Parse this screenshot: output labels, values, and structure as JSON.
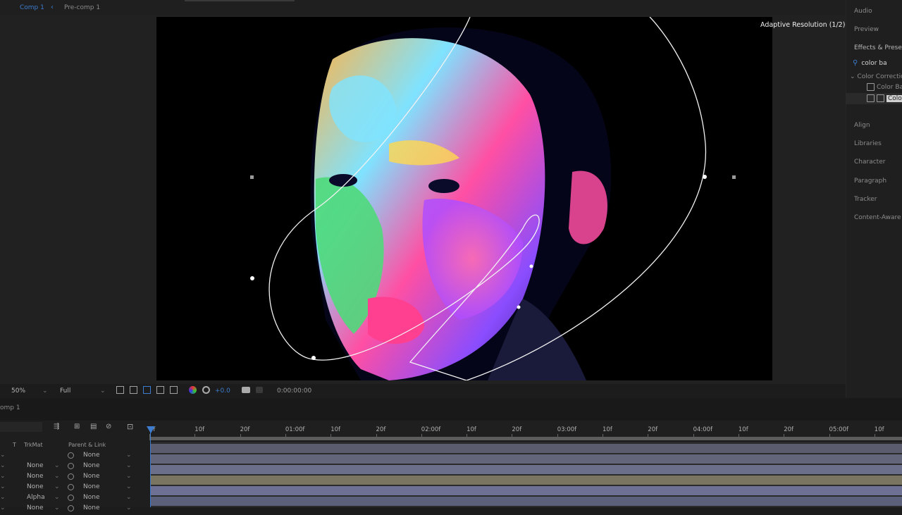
{
  "breadcrumb": {
    "comp": "Comp 1",
    "separator": "‹",
    "precomp": "Pre-comp 1"
  },
  "viewer": {
    "adaptive_resolution": "Adaptive Resolution (1/2)"
  },
  "right_panel": {
    "items_top": [
      "Audio",
      "Preview",
      "Effects & Presets"
    ],
    "search_value": "color ba",
    "category": "Color Correctio",
    "effect_1": "Color Ba",
    "effect_2": "Colo",
    "items_bottom": [
      "Align",
      "Libraries",
      "Character",
      "Paragraph",
      "Tracker",
      "Content-Aware"
    ]
  },
  "viewer_toolbar": {
    "zoom": "50%",
    "resolution": "Full",
    "exposure": "+0.0",
    "timecode": "0:00:00:00"
  },
  "timeline": {
    "tab": "omp 1",
    "columns": {
      "t": "T",
      "trkmat": "TrkMat",
      "parent": "Parent & Link"
    },
    "ruler_ticks": [
      "0f",
      "10f",
      "20f",
      "01:00f",
      "10f",
      "20f",
      "02:00f",
      "10f",
      "20f",
      "03:00f",
      "10f",
      "20f",
      "04:00f",
      "10f",
      "20f",
      "05:00f",
      "10f"
    ],
    "layers": [
      {
        "trkmat": "",
        "parent": "None"
      },
      {
        "trkmat": "None",
        "parent": "None"
      },
      {
        "trkmat": "None",
        "parent": "None"
      },
      {
        "trkmat": "None",
        "parent": "None"
      },
      {
        "trkmat": "Alpha",
        "parent": "None"
      },
      {
        "trkmat": "None",
        "parent": "None"
      }
    ],
    "track_colors": [
      "#5b5d6e",
      "#63657a",
      "#6b6f8a",
      "#7a7560",
      "#6e7094",
      "#5d607a"
    ]
  },
  "colors": {
    "accent": "#3d7ccf",
    "canvas": "#000000"
  }
}
